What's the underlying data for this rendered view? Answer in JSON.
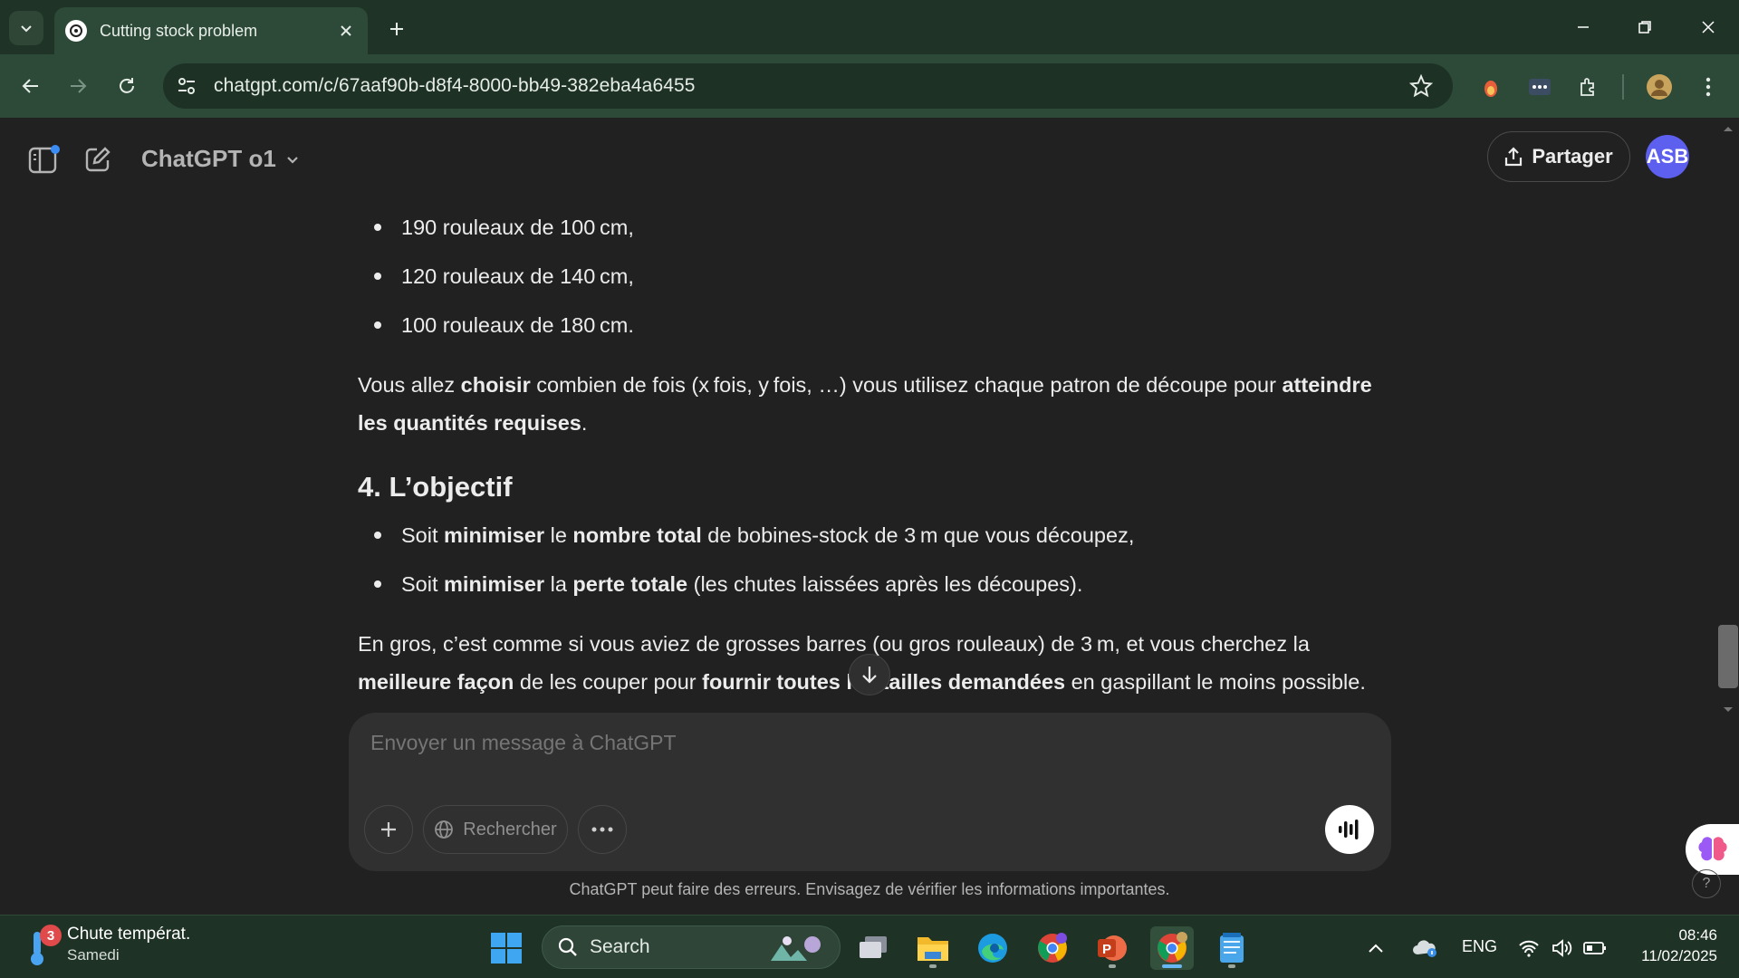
{
  "browser": {
    "tab_title": "Cutting stock problem",
    "url": "chatgpt.com/c/67aaf90b-d8f4-8000-bb49-382eba4a6455"
  },
  "app": {
    "model_label": "ChatGPT o1",
    "share_label": "Partager",
    "avatar_initials": "ASB"
  },
  "content": {
    "top_bullets": [
      "190 rouleaux de 100 cm,",
      "120 rouleaux de 140 cm,",
      "100 rouleaux de 180 cm."
    ],
    "para1": {
      "t1": "Vous allez ",
      "b1": "choisir",
      "t2": " combien de fois (x fois, y fois, …) vous utilisez chaque patron de découpe pour ",
      "b2": "atteindre les quantités requises",
      "t3": "."
    },
    "objective_heading": "4. L’objectif",
    "objective_bullets": [
      {
        "t1": "Soit ",
        "b1": "minimiser",
        "t2": " le ",
        "b2": "nombre total",
        "t3": " de bobines-stock de 3 m que vous découpez,"
      },
      {
        "t1": "Soit ",
        "b1": "minimiser",
        "t2": " la ",
        "b2": "perte totale",
        "t3": " (les chutes laissées après les découpes)."
      }
    ],
    "para2": {
      "t1": "En gros, c’est comme si vous aviez de grosses barres (ou gros rouleaux) de 3 m, et vous cherchez la ",
      "b1": "meilleure façon",
      "t2": " de les couper pour ",
      "b2": "fournir toutes les tailles demandées",
      "t3": " en gaspillant le moins possible."
    }
  },
  "composer": {
    "placeholder": "Envoyer un message à ChatGPT",
    "search_label": "Rechercher"
  },
  "disclaimer": "ChatGPT peut faire des erreurs. Envisagez de vérifier les informations importantes.",
  "taskbar": {
    "weather_title": "Chute températ.",
    "weather_day": "Samedi",
    "weather_badge": "3",
    "search_label": "Search",
    "language": "ENG",
    "time": "08:46",
    "date": "11/02/2025"
  },
  "colors": {
    "chrome_frame": "#1f3326",
    "chrome_toolbar": "#2c4a37",
    "app_bg": "#212121",
    "composer_bg": "#303030",
    "avatar_bg": "#5d5fef"
  },
  "icons": [
    "chevron-down-icon",
    "openai-logo-icon",
    "close-icon",
    "plus-icon",
    "back-icon",
    "forward-icon",
    "reload-icon",
    "site-info-icon",
    "star-icon",
    "extension-icon",
    "sidebar-icon",
    "new-chat-icon",
    "share-icon",
    "arrow-down-icon",
    "globe-icon",
    "more-icon",
    "voice-icon",
    "windows-start-icon",
    "search-icon"
  ]
}
